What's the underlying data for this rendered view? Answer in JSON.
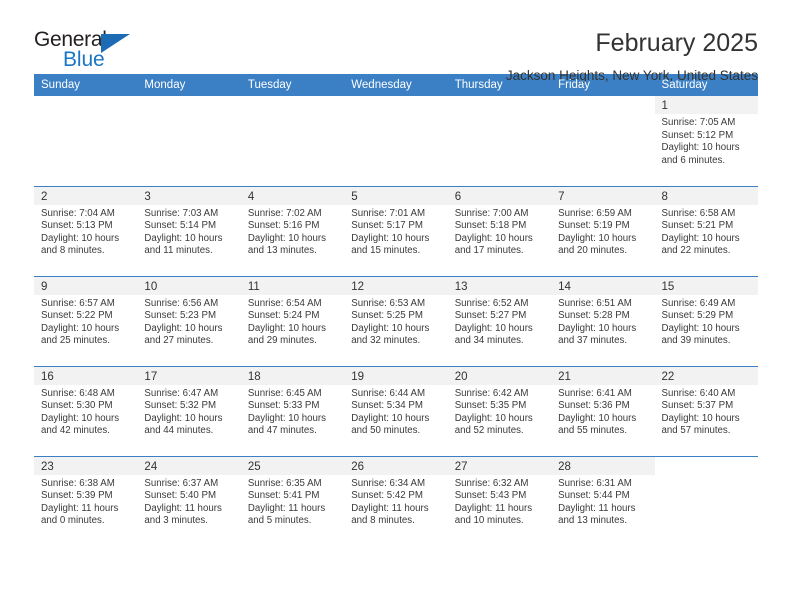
{
  "logo": {
    "word1": "General",
    "word2": "Blue",
    "triangle_icon": "triangle-icon",
    "color_dark": "#231f20",
    "color_blue": "#1b76c4"
  },
  "header": {
    "title": "February 2025",
    "location": "Jackson Heights, New York, United States"
  },
  "colors": {
    "header_blue": "#3b7fc4",
    "daynum_band": "#f2f2f2",
    "text": "#333333"
  },
  "calendar": {
    "weekday_headers": [
      "Sunday",
      "Monday",
      "Tuesday",
      "Wednesday",
      "Thursday",
      "Friday",
      "Saturday"
    ],
    "weeks": [
      [
        {
          "empty": true
        },
        {
          "empty": true
        },
        {
          "empty": true
        },
        {
          "empty": true
        },
        {
          "empty": true
        },
        {
          "empty": true
        },
        {
          "day": "1",
          "sunrise": "Sunrise: 7:05 AM",
          "sunset": "Sunset: 5:12 PM",
          "daylight": "Daylight: 10 hours and 6 minutes."
        }
      ],
      [
        {
          "day": "2",
          "sunrise": "Sunrise: 7:04 AM",
          "sunset": "Sunset: 5:13 PM",
          "daylight": "Daylight: 10 hours and 8 minutes."
        },
        {
          "day": "3",
          "sunrise": "Sunrise: 7:03 AM",
          "sunset": "Sunset: 5:14 PM",
          "daylight": "Daylight: 10 hours and 11 minutes."
        },
        {
          "day": "4",
          "sunrise": "Sunrise: 7:02 AM",
          "sunset": "Sunset: 5:16 PM",
          "daylight": "Daylight: 10 hours and 13 minutes."
        },
        {
          "day": "5",
          "sunrise": "Sunrise: 7:01 AM",
          "sunset": "Sunset: 5:17 PM",
          "daylight": "Daylight: 10 hours and 15 minutes."
        },
        {
          "day": "6",
          "sunrise": "Sunrise: 7:00 AM",
          "sunset": "Sunset: 5:18 PM",
          "daylight": "Daylight: 10 hours and 17 minutes."
        },
        {
          "day": "7",
          "sunrise": "Sunrise: 6:59 AM",
          "sunset": "Sunset: 5:19 PM",
          "daylight": "Daylight: 10 hours and 20 minutes."
        },
        {
          "day": "8",
          "sunrise": "Sunrise: 6:58 AM",
          "sunset": "Sunset: 5:21 PM",
          "daylight": "Daylight: 10 hours and 22 minutes."
        }
      ],
      [
        {
          "day": "9",
          "sunrise": "Sunrise: 6:57 AM",
          "sunset": "Sunset: 5:22 PM",
          "daylight": "Daylight: 10 hours and 25 minutes."
        },
        {
          "day": "10",
          "sunrise": "Sunrise: 6:56 AM",
          "sunset": "Sunset: 5:23 PM",
          "daylight": "Daylight: 10 hours and 27 minutes."
        },
        {
          "day": "11",
          "sunrise": "Sunrise: 6:54 AM",
          "sunset": "Sunset: 5:24 PM",
          "daylight": "Daylight: 10 hours and 29 minutes."
        },
        {
          "day": "12",
          "sunrise": "Sunrise: 6:53 AM",
          "sunset": "Sunset: 5:25 PM",
          "daylight": "Daylight: 10 hours and 32 minutes."
        },
        {
          "day": "13",
          "sunrise": "Sunrise: 6:52 AM",
          "sunset": "Sunset: 5:27 PM",
          "daylight": "Daylight: 10 hours and 34 minutes."
        },
        {
          "day": "14",
          "sunrise": "Sunrise: 6:51 AM",
          "sunset": "Sunset: 5:28 PM",
          "daylight": "Daylight: 10 hours and 37 minutes."
        },
        {
          "day": "15",
          "sunrise": "Sunrise: 6:49 AM",
          "sunset": "Sunset: 5:29 PM",
          "daylight": "Daylight: 10 hours and 39 minutes."
        }
      ],
      [
        {
          "day": "16",
          "sunrise": "Sunrise: 6:48 AM",
          "sunset": "Sunset: 5:30 PM",
          "daylight": "Daylight: 10 hours and 42 minutes."
        },
        {
          "day": "17",
          "sunrise": "Sunrise: 6:47 AM",
          "sunset": "Sunset: 5:32 PM",
          "daylight": "Daylight: 10 hours and 44 minutes."
        },
        {
          "day": "18",
          "sunrise": "Sunrise: 6:45 AM",
          "sunset": "Sunset: 5:33 PM",
          "daylight": "Daylight: 10 hours and 47 minutes."
        },
        {
          "day": "19",
          "sunrise": "Sunrise: 6:44 AM",
          "sunset": "Sunset: 5:34 PM",
          "daylight": "Daylight: 10 hours and 50 minutes."
        },
        {
          "day": "20",
          "sunrise": "Sunrise: 6:42 AM",
          "sunset": "Sunset: 5:35 PM",
          "daylight": "Daylight: 10 hours and 52 minutes."
        },
        {
          "day": "21",
          "sunrise": "Sunrise: 6:41 AM",
          "sunset": "Sunset: 5:36 PM",
          "daylight": "Daylight: 10 hours and 55 minutes."
        },
        {
          "day": "22",
          "sunrise": "Sunrise: 6:40 AM",
          "sunset": "Sunset: 5:37 PM",
          "daylight": "Daylight: 10 hours and 57 minutes."
        }
      ],
      [
        {
          "day": "23",
          "sunrise": "Sunrise: 6:38 AM",
          "sunset": "Sunset: 5:39 PM",
          "daylight": "Daylight: 11 hours and 0 minutes."
        },
        {
          "day": "24",
          "sunrise": "Sunrise: 6:37 AM",
          "sunset": "Sunset: 5:40 PM",
          "daylight": "Daylight: 11 hours and 3 minutes."
        },
        {
          "day": "25",
          "sunrise": "Sunrise: 6:35 AM",
          "sunset": "Sunset: 5:41 PM",
          "daylight": "Daylight: 11 hours and 5 minutes."
        },
        {
          "day": "26",
          "sunrise": "Sunrise: 6:34 AM",
          "sunset": "Sunset: 5:42 PM",
          "daylight": "Daylight: 11 hours and 8 minutes."
        },
        {
          "day": "27",
          "sunrise": "Sunrise: 6:32 AM",
          "sunset": "Sunset: 5:43 PM",
          "daylight": "Daylight: 11 hours and 10 minutes."
        },
        {
          "day": "28",
          "sunrise": "Sunrise: 6:31 AM",
          "sunset": "Sunset: 5:44 PM",
          "daylight": "Daylight: 11 hours and 13 minutes."
        },
        {
          "empty": true
        }
      ]
    ]
  }
}
